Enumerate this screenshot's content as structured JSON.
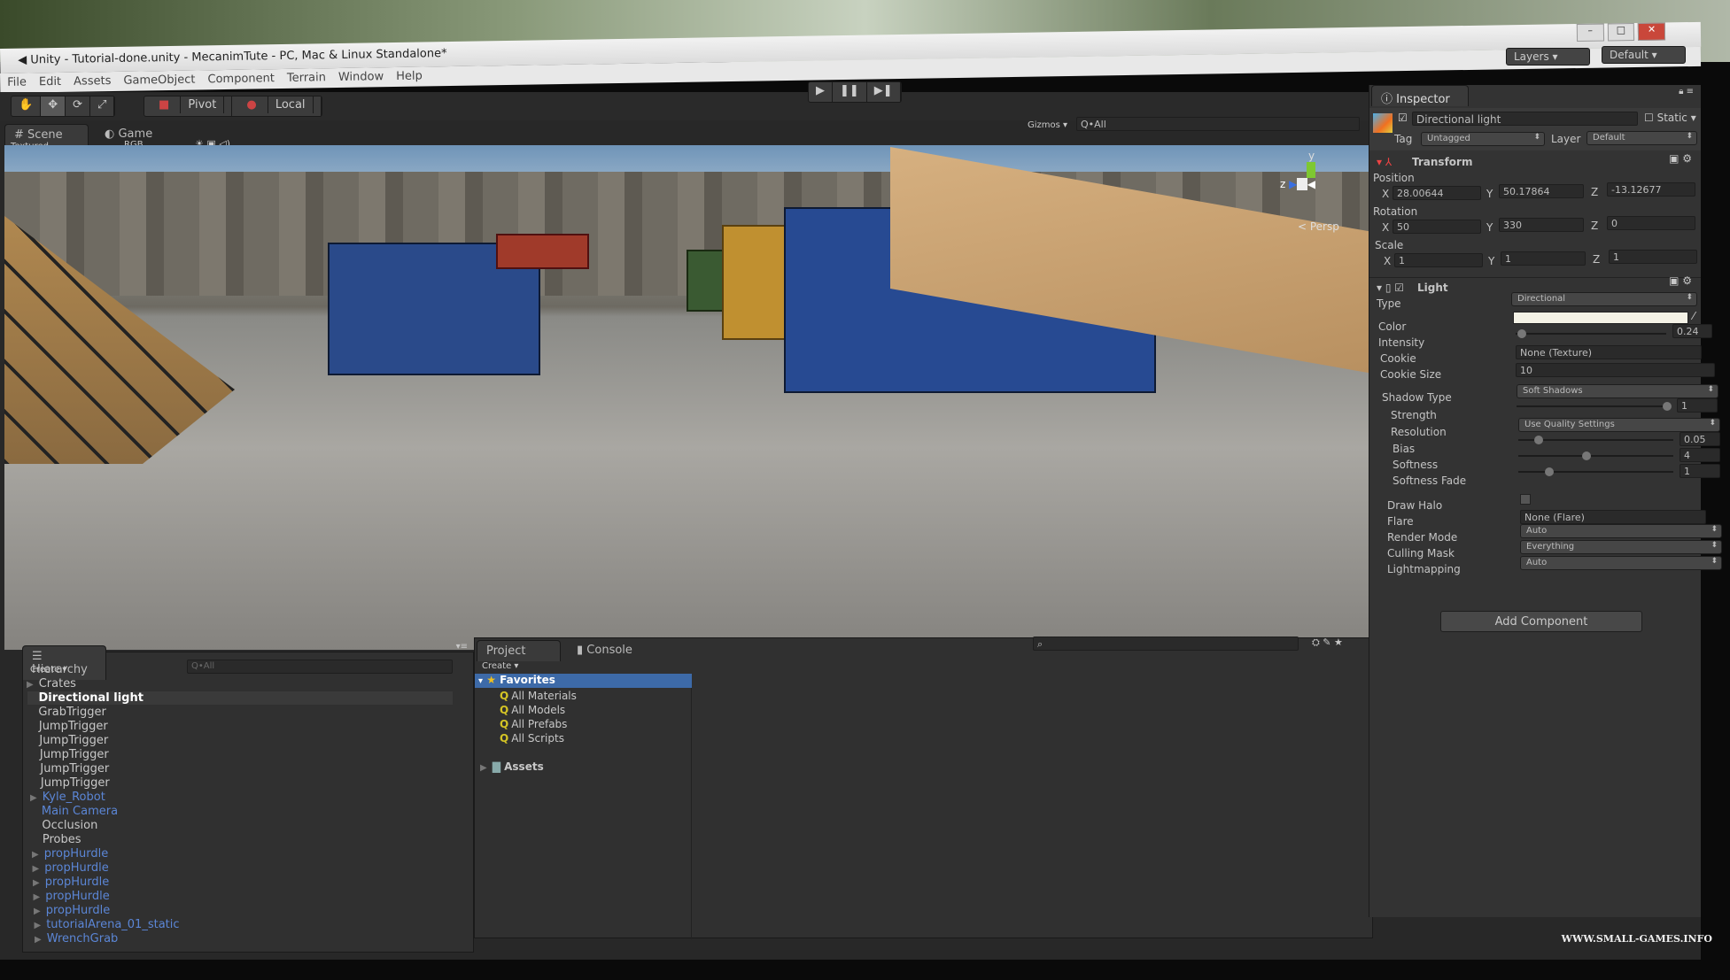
{
  "window": {
    "title": "Unity - Tutorial-done.unity - MecanimTute - PC, Mac & Linux Standalone*",
    "controls": [
      "–",
      "□",
      "✕"
    ]
  },
  "menu": [
    "File",
    "Edit",
    "Assets",
    "GameObject",
    "Component",
    "Terrain",
    "Window",
    "Help"
  ],
  "toolbar": {
    "tools": [
      "hand-icon",
      "move-icon",
      "rotate-icon",
      "scale-icon"
    ],
    "tool_glyphs": [
      "✋",
      "✥",
      "⟳",
      "⤢"
    ],
    "pivot": "Pivot",
    "local": "Local",
    "play": "▶",
    "pause": "❚❚",
    "step": "▶❚",
    "layers": "Layers",
    "layout": "Default"
  },
  "scene": {
    "tabs": [
      "Scene",
      "Game"
    ],
    "shading": "Textured",
    "render_mode": "RGB",
    "gizmos": "Gizmos",
    "search_placeholder": "Q•All",
    "persp": "< Persp",
    "axis_y": "y",
    "axis_z": "z"
  },
  "inspector": {
    "tab": "Inspector",
    "object_name": "Directional light",
    "static": "Static",
    "tag_label": "Tag",
    "tag": "Untagged",
    "layer_label": "Layer",
    "layer": "Default",
    "transform": {
      "title": "Transform",
      "position_label": "Position",
      "rotation_label": "Rotation",
      "scale_label": "Scale",
      "position": {
        "x": "28.00644",
        "y": "50.17864",
        "z": "-13.12677"
      },
      "rotation": {
        "x": "50",
        "y": "330",
        "z": "0"
      },
      "scale": {
        "x": "1",
        "y": "1",
        "z": "1"
      }
    },
    "light": {
      "title": "Light",
      "type_label": "Type",
      "type": "Directional",
      "color_label": "Color",
      "color": "#f4f2e6",
      "intensity_label": "Intensity",
      "intensity": "0.24",
      "cookie_label": "Cookie",
      "cookie": "None (Texture)",
      "cookie_size_label": "Cookie Size",
      "cookie_size": "10",
      "shadow_type_label": "Shadow Type",
      "shadow_type": "Soft Shadows",
      "strength_label": "Strength",
      "strength": "1",
      "resolution_label": "Resolution",
      "resolution": "Use Quality Settings",
      "bias_label": "Bias",
      "bias": "0.05",
      "softness_label": "Softness",
      "softness": "4",
      "softness_fade_label": "Softness Fade",
      "softness_fade": "1",
      "draw_halo_label": "Draw Halo",
      "flare_label": "Flare",
      "flare": "None (Flare)",
      "render_mode_label": "Render Mode",
      "render_mode": "Auto",
      "culling_mask_label": "Culling Mask",
      "culling_mask": "Everything",
      "lightmapping_label": "Lightmapping",
      "lightmapping": "Auto"
    },
    "add_component": "Add Component"
  },
  "hierarchy": {
    "tab": "Hierarchy",
    "create": "Create ▾",
    "search_placeholder": "Q•All",
    "items": [
      {
        "label": "Crates",
        "prefab": false,
        "expandable": true
      },
      {
        "label": "Directional light",
        "prefab": false,
        "selected": true
      },
      {
        "label": "GrabTrigger",
        "prefab": false
      },
      {
        "label": "JumpTrigger",
        "prefab": false
      },
      {
        "label": "JumpTrigger",
        "prefab": false
      },
      {
        "label": "JumpTrigger",
        "prefab": false
      },
      {
        "label": "JumpTrigger",
        "prefab": false
      },
      {
        "label": "JumpTrigger",
        "prefab": false
      },
      {
        "label": "Kyle_Robot",
        "prefab": true,
        "expandable": true
      },
      {
        "label": "Main Camera",
        "prefab": true
      },
      {
        "label": "Occlusion",
        "prefab": false
      },
      {
        "label": "Probes",
        "prefab": false
      },
      {
        "label": "propHurdle",
        "prefab": true,
        "expandable": true
      },
      {
        "label": "propHurdle",
        "prefab": true,
        "expandable": true
      },
      {
        "label": "propHurdle",
        "prefab": true,
        "expandable": true
      },
      {
        "label": "propHurdle",
        "prefab": true,
        "expandable": true
      },
      {
        "label": "propHurdle",
        "prefab": true,
        "expandable": true
      },
      {
        "label": "tutorialArena_01_static",
        "prefab": true,
        "expandable": true
      },
      {
        "label": "WrenchGrab",
        "prefab": true,
        "expandable": true
      }
    ]
  },
  "project": {
    "tabs": [
      "Project",
      "Console"
    ],
    "create": "Create ▾",
    "favorites": "Favorites",
    "favorites_items": [
      "All Materials",
      "All Models",
      "All Prefabs",
      "All Scripts"
    ],
    "assets": "Assets"
  },
  "watermark": "WWW.SMALL-GAMES.INFO",
  "colors": {
    "selection": "#3d6aa8",
    "prefab_text": "#5b86d6",
    "panel": "#303030"
  }
}
